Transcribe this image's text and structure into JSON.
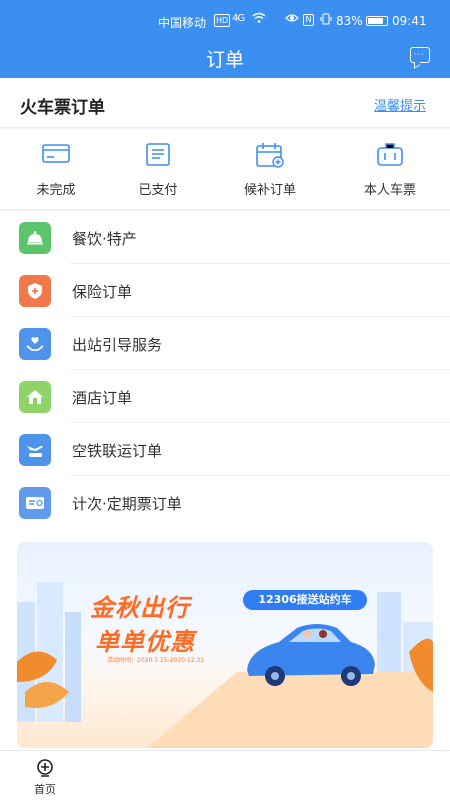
{
  "status_bar": {
    "carrier": "中国移动",
    "hd": "HD",
    "signal": "4G",
    "nfc": "N",
    "battery_percent": "83%",
    "battery_level": 0.83,
    "time": "09:41"
  },
  "header": {
    "title": "订单"
  },
  "section": {
    "title": "火车票订单",
    "tip": "温馨提示"
  },
  "order_status": [
    {
      "label": "未完成",
      "icon": "card-icon"
    },
    {
      "label": "已支付",
      "icon": "receipt-icon"
    },
    {
      "label": "候补订单",
      "icon": "calendar-add-icon"
    },
    {
      "label": "本人车票",
      "icon": "suitcase-icon"
    }
  ],
  "menu": [
    {
      "label": "餐饮·特产",
      "icon": "dining-bell-icon",
      "color": "#5cc46a"
    },
    {
      "label": "保险订单",
      "icon": "shield-plus-icon",
      "color": "#f0784a"
    },
    {
      "label": "出站引导服务",
      "icon": "hand-heart-icon",
      "color": "#4f93ea"
    },
    {
      "label": "酒店订单",
      "icon": "hotel-icon",
      "color": "#8fd468"
    },
    {
      "label": "空铁联运订单",
      "icon": "plane-train-icon",
      "color": "#4f93ea"
    },
    {
      "label": "计次·定期票订单",
      "icon": "ticket-icon",
      "color": "#5f9bea"
    }
  ],
  "banner": {
    "line1": "金秋出行",
    "line2": "单单优惠",
    "tag": "12306接送站约车",
    "date": "活动时间：2020.7.15-2020.12.31"
  },
  "tabbar": [
    {
      "label": "首页",
      "icon": "home-train-icon"
    }
  ],
  "colors": {
    "primary": "#3b8ff0",
    "accent_orange": "#ff6b21"
  }
}
